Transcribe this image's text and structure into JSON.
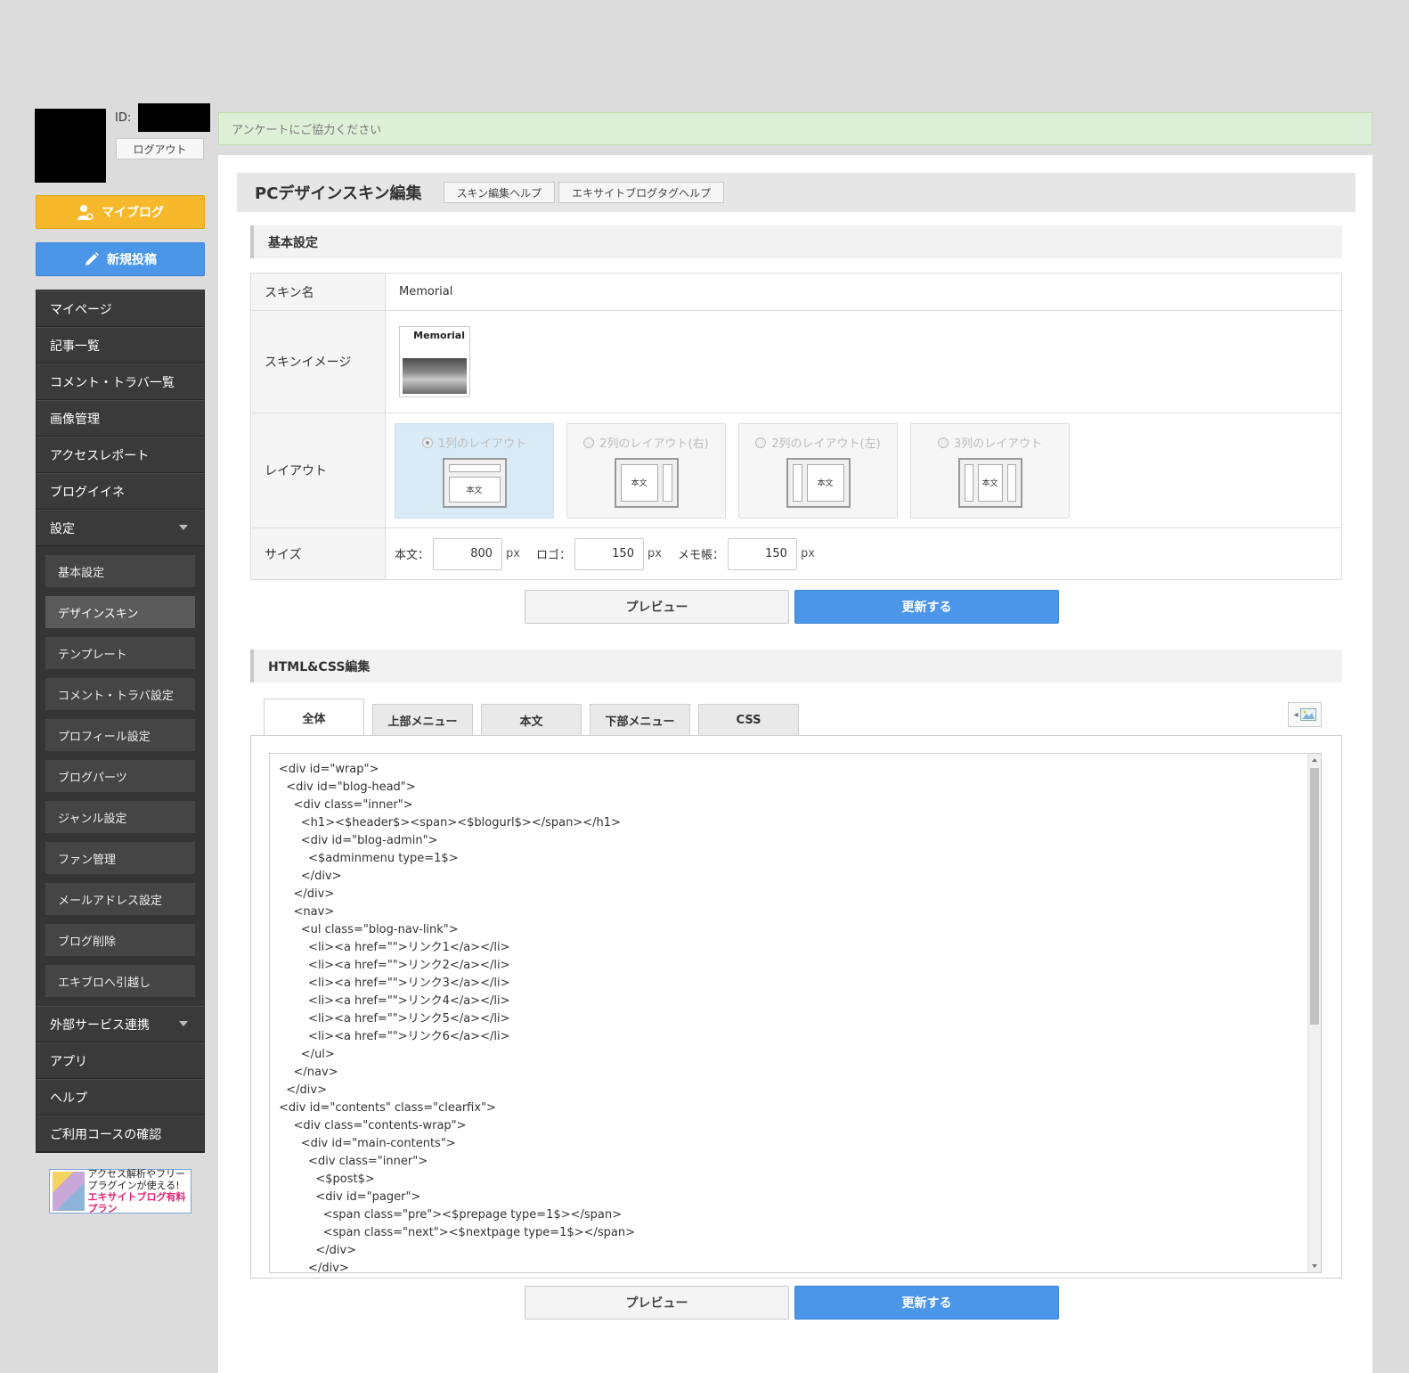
{
  "user": {
    "id_label": "ID:",
    "logout_label": "ログアウト"
  },
  "buttons": {
    "myblog": "マイブログ",
    "newpost": "新規投稿"
  },
  "sidebar": {
    "items": [
      {
        "label": "マイページ"
      },
      {
        "label": "記事一覧"
      },
      {
        "label": "コメント・トラバ一覧"
      },
      {
        "label": "画像管理"
      },
      {
        "label": "アクセスレポート"
      },
      {
        "label": "ブログイイネ"
      },
      {
        "label": "設定"
      }
    ],
    "sub_items": [
      {
        "label": "基本設定"
      },
      {
        "label": "デザインスキン"
      },
      {
        "label": "テンプレート"
      },
      {
        "label": "コメント・トラバ設定"
      },
      {
        "label": "プロフィール設定"
      },
      {
        "label": "ブログパーツ"
      },
      {
        "label": "ジャンル設定"
      },
      {
        "label": "ファン管理"
      },
      {
        "label": "メールアドレス設定"
      },
      {
        "label": "ブログ削除"
      },
      {
        "label": "エキブロへ引越し"
      }
    ],
    "bottom_items": [
      {
        "label": "外部サービス連携"
      },
      {
        "label": "アプリ"
      },
      {
        "label": "ヘルプ"
      },
      {
        "label": "ご利用コースの確認"
      }
    ],
    "active_sub": "デザインスキン"
  },
  "banner": {
    "line1": "アクセス解析やフリー",
    "line2": "プラグインが使える!",
    "line3": "エキサイトブログ有料プラン"
  },
  "notice": "アンケートにご協力ください",
  "page": {
    "title": "PCデザインスキン編集",
    "help1": "スキン編集ヘルプ",
    "help2": "エキサイトブログタグヘルプ"
  },
  "basic": {
    "heading": "基本設定",
    "skin_name_label": "スキン名",
    "skin_name": "Memorial",
    "skin_image_label": "スキンイメージ",
    "skin_image_title": "Memorial",
    "layout_label": "レイアウト",
    "layouts": [
      {
        "label": "1列のレイアウト",
        "selected": true
      },
      {
        "label": "2列のレイアウト(右)",
        "selected": false
      },
      {
        "label": "2列のレイアウト(左)",
        "selected": false
      },
      {
        "label": "3列のレイアウト",
        "selected": false
      }
    ],
    "body_text": "本文",
    "size_label": "サイズ",
    "sizes": [
      {
        "label": "本文：",
        "value": "800",
        "unit": "px"
      },
      {
        "label": "ロゴ：",
        "value": "150",
        "unit": "px"
      },
      {
        "label": "メモ帳：",
        "value": "150",
        "unit": "px"
      }
    ]
  },
  "actions": {
    "preview": "プレビュー",
    "update": "更新する"
  },
  "editor": {
    "heading": "HTML&CSS編集",
    "tabs": [
      {
        "label": "全体",
        "active": true
      },
      {
        "label": "上部メニュー",
        "active": false
      },
      {
        "label": "本文",
        "active": false
      },
      {
        "label": "下部メニュー",
        "active": false
      },
      {
        "label": "CSS",
        "active": false
      }
    ],
    "code": "<div id=\"wrap\">\n  <div id=\"blog-head\">\n    <div class=\"inner\">\n      <h1><$header$><span><$blogurl$></span></h1>\n      <div id=\"blog-admin\">\n        <$adminmenu type=1$>\n      </div>\n    </div>\n    <nav>\n      <ul class=\"blog-nav-link\">\n        <li><a href=\"\">リンク1</a></li>\n        <li><a href=\"\">リンク2</a></li>\n        <li><a href=\"\">リンク3</a></li>\n        <li><a href=\"\">リンク4</a></li>\n        <li><a href=\"\">リンク5</a></li>\n        <li><a href=\"\">リンク6</a></li>\n      </ul>\n    </nav>\n  </div>\n<div id=\"contents\" class=\"clearfix\">\n    <div class=\"contents-wrap\">\n      <div id=\"main-contents\">\n        <div class=\"inner\">\n          <$post$>\n          <div id=\"pager\">\n            <span class=\"pre\"><$prepage type=1$></span>\n            <span class=\"next\"><$nextpage type=1$></span>\n          </div>\n        </div>"
  },
  "colors": {
    "accent": "#4b96e8",
    "myblog": "#f7b92b",
    "sidebar": "#3a3a3a",
    "notice_bg": "#dff0d8"
  }
}
